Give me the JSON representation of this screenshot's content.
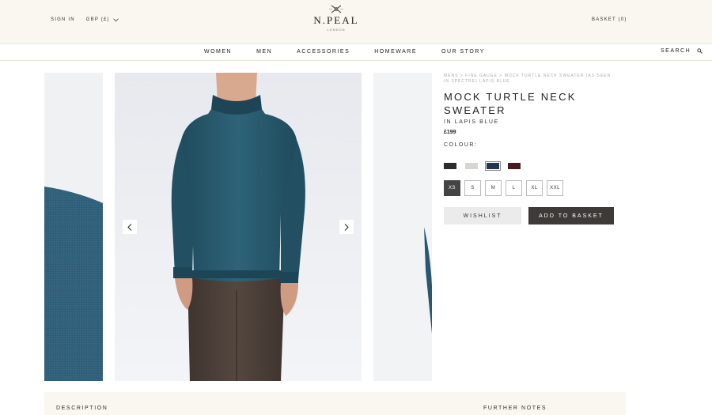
{
  "header": {
    "sign_in": "SIGN IN",
    "currency": "GBP (£)",
    "logo_name": "N.PEAL",
    "logo_sub": "LONDON",
    "basket": "BASKET (0)"
  },
  "nav": {
    "items": [
      "WOMEN",
      "MEN",
      "ACCESSORIES",
      "HOMEWARE",
      "OUR STORY"
    ],
    "search": "SEARCH"
  },
  "breadcrumb": {
    "items": [
      "MENS",
      "FINE GAUGE",
      "MOCK TURTLE NECK SWEATER (AS SEEN IN SPECTRE) LAPIS BLUE"
    ],
    "separator": " > "
  },
  "product": {
    "title": "MOCK TURTLE NECK SWEATER",
    "subtitle": "IN LAPIS BLUE",
    "price": "£199",
    "colour_label": "COLOUR:",
    "swatches": [
      {
        "name": "black",
        "color": "#2b2b2b",
        "selected": false
      },
      {
        "name": "light grey",
        "color": "#d8d6d2",
        "selected": false
      },
      {
        "name": "lapis blue",
        "color": "#1f3551",
        "selected": true
      },
      {
        "name": "burgundy",
        "color": "#4a1a24",
        "selected": false
      }
    ],
    "sizes": [
      "XS",
      "S",
      "M",
      "L",
      "XL",
      "XXL"
    ],
    "selected_size": "XS",
    "wishlist": "WISHLIST",
    "add_to_basket": "ADD TO BASKET"
  },
  "tabs": {
    "description": "DESCRIPTION",
    "further_notes": "FURTHER NOTES"
  },
  "colors": {
    "header_bg": "#faf6f0",
    "sweater": "#2b5b6e",
    "trousers": "#4a3d36",
    "dark_button": "#3d3a38"
  }
}
